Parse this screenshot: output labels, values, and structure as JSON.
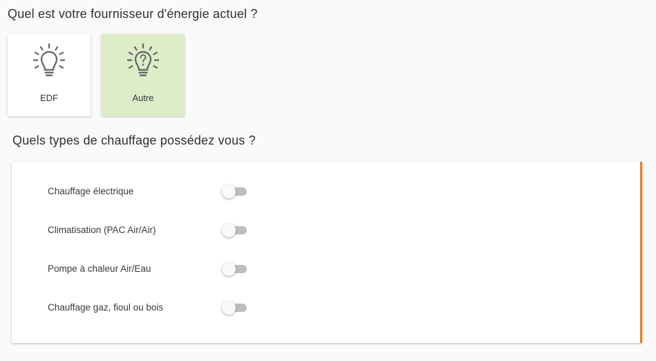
{
  "provider_question": {
    "title": "Quel est votre fournisseur d'énergie actuel ?",
    "options": [
      {
        "label": "EDF",
        "icon": "lightbulb-icon",
        "selected": false
      },
      {
        "label": "Autre",
        "icon": "lightbulb-question-icon",
        "selected": true
      }
    ]
  },
  "heating_question": {
    "title": "Quels types de chauffage possédez vous ?",
    "items": [
      {
        "label": "Chauffage électrique",
        "checked": false
      },
      {
        "label": "Climatisation (PAC Air/Air)",
        "checked": false
      },
      {
        "label": "Pompe à chaleur Air/Eau",
        "checked": false
      },
      {
        "label": "Chauffage gaz, fioul ou bois",
        "checked": false
      }
    ]
  },
  "colors": {
    "selected_card": "#dcedc8",
    "panel_accent": "#e67e22",
    "icon_color": "#6b6b6b",
    "toggle_track_off": "#bdbdbd"
  }
}
